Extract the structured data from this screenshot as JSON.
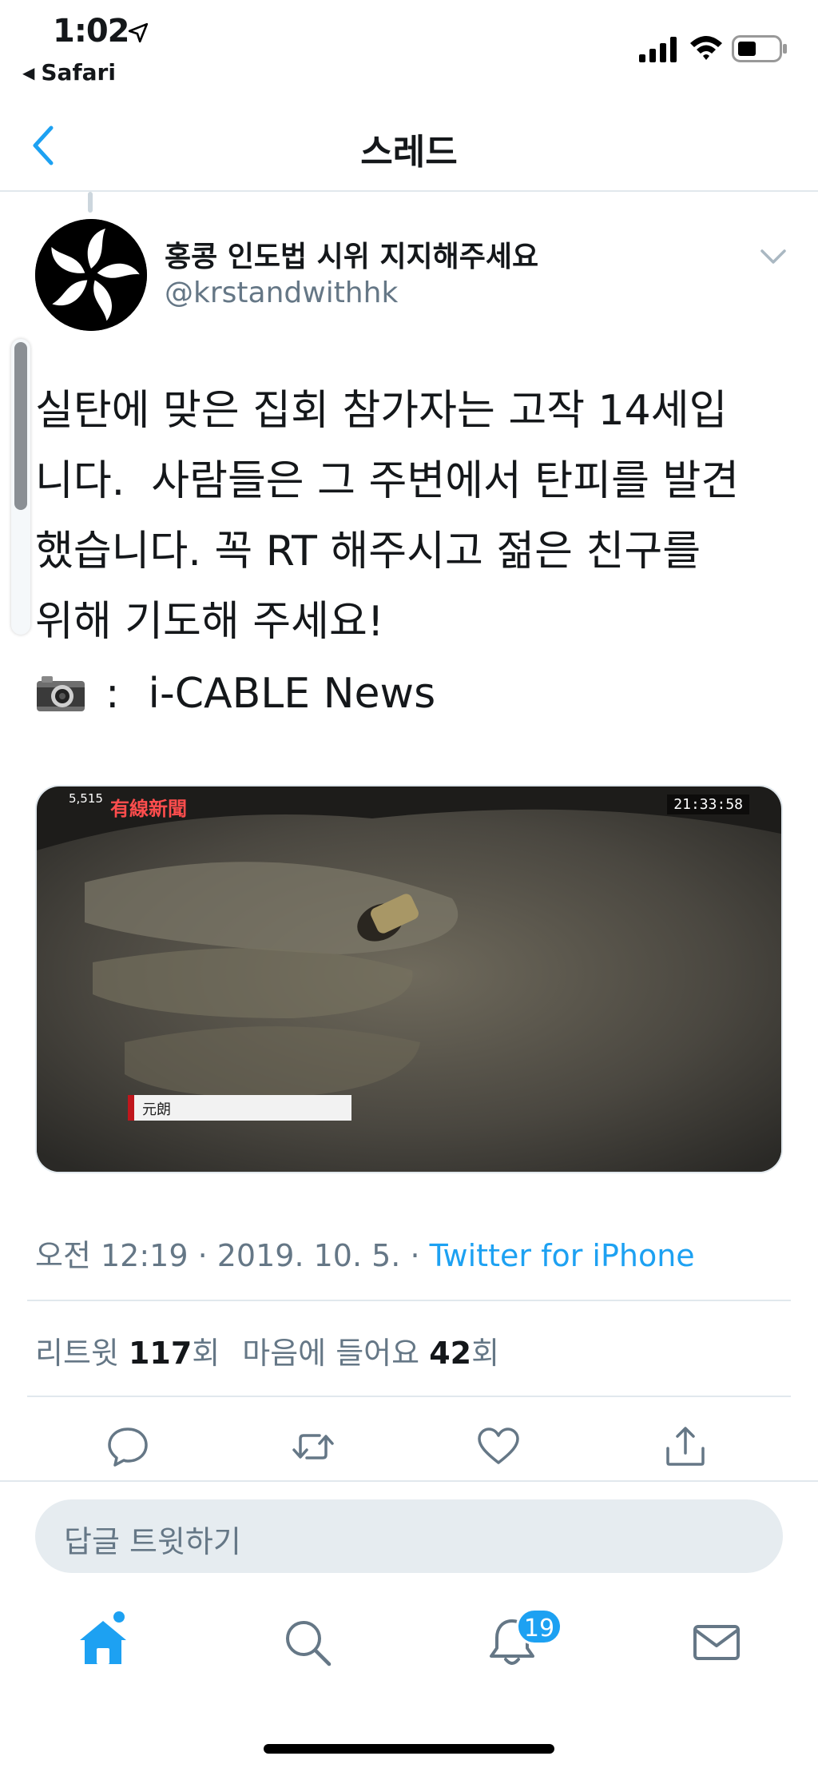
{
  "status_bar": {
    "time": "1:02",
    "back_app": "Safari"
  },
  "nav": {
    "title": "스레드"
  },
  "author": {
    "name": "홍콩 인도법 시위 지지해주세요",
    "handle": "@krstandwithhk"
  },
  "tweet": {
    "text": "실탄에 맞은 집회 참가자는 고작 14세입\n니다.  사람들은 그 주변에서 탄피를 발견\n했습니다. 꼭 RT 해주시고 젊은 친구를\n위해 기도해 주세요!",
    "credit_separator": ":",
    "credit_source": "i-CABLE News",
    "media": {
      "clock": "21:33:58",
      "views": "5,515",
      "logo": "有線新聞",
      "caption": "元朗"
    }
  },
  "meta": {
    "datetime": "오전 12:19 · 2019. 10. 5. · ",
    "source": "Twitter for iPhone"
  },
  "stats": {
    "retweets_label": "리트윗 ",
    "retweets_count": "117",
    "retweets_unit": "회",
    "likes_label": "마음에 들어요 ",
    "likes_count": "42",
    "likes_unit": "회"
  },
  "reply": {
    "placeholder": "답글 트윗하기"
  },
  "tab_bar": {
    "notifications_badge": "19"
  },
  "icons": {
    "accent": "#1da1f2",
    "muted": "#657786"
  }
}
